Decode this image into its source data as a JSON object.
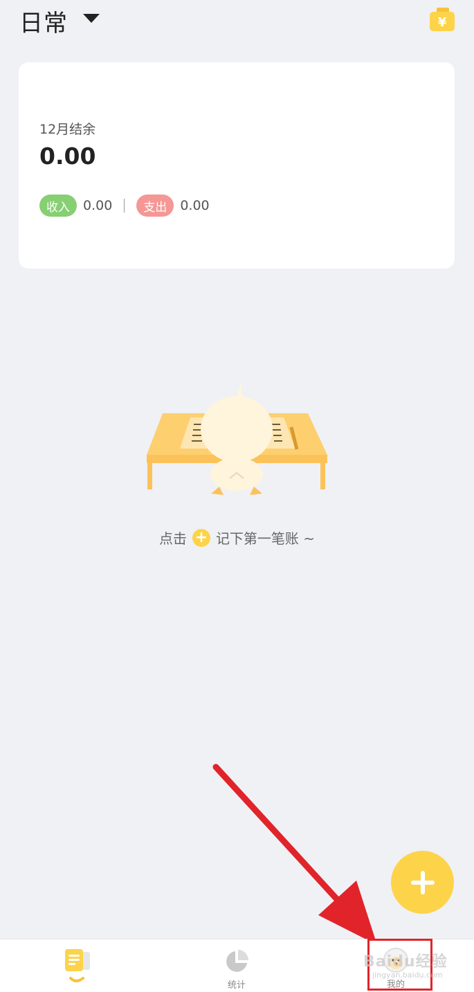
{
  "header": {
    "book_name": "日常",
    "caret_icon": "caret-down-icon",
    "wallet_icon": "wallet-icon",
    "wallet_symbol": "¥"
  },
  "summary": {
    "balance_label": "12月结余",
    "balance_value": "0.00",
    "income_label": "收入",
    "income_value": "0.00",
    "expense_label": "支出",
    "expense_value": "0.00"
  },
  "empty_state": {
    "illustration": "duck-at-desk-illustration",
    "hint_before": "点击",
    "hint_after": "记下第一笔账 ~"
  },
  "fab": {
    "icon": "plus-icon"
  },
  "tabs": [
    {
      "label": "",
      "icon": "notebook-icon",
      "active": true
    },
    {
      "label": "统计",
      "icon": "pie-chart-icon",
      "active": false
    },
    {
      "label": "我的",
      "icon": "avatar-icon",
      "active": false
    }
  ],
  "overlay": {
    "watermark": "Baidu经验",
    "watermark_sub": "jingyan.baidu.com"
  },
  "colors": {
    "accent": "#fdd34a",
    "income": "#86cf72",
    "expense": "#f59795",
    "background": "#f0f1f5",
    "annotation": "#e0242a"
  }
}
